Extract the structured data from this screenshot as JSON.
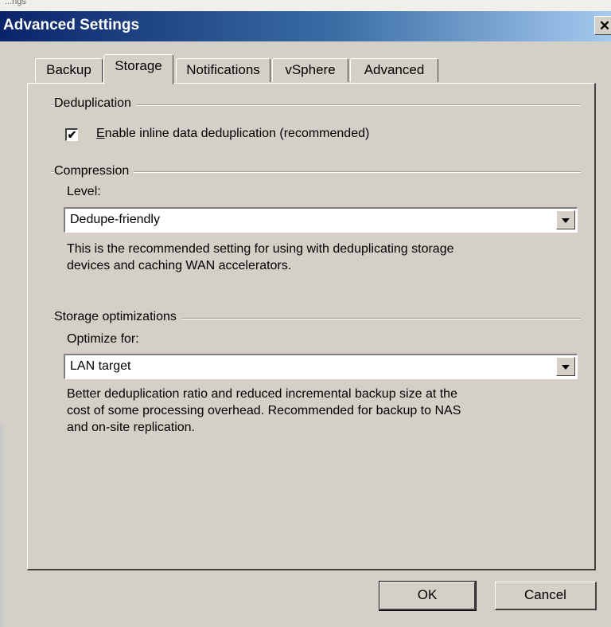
{
  "window": {
    "caption_fragment": "...ngs",
    "title": "Advanced Settings",
    "close_glyph": "✕"
  },
  "tabs": [
    {
      "label": "Backup",
      "active": false
    },
    {
      "label": "Storage",
      "active": true
    },
    {
      "label": "Notifications",
      "active": false
    },
    {
      "label": "vSphere",
      "active": false
    },
    {
      "label": "Advanced",
      "active": false
    }
  ],
  "deduplication": {
    "group_label": "Deduplication",
    "checkbox_checked": true,
    "checkbox_mark": "✔",
    "checkbox_label_accel": "E",
    "checkbox_label_rest": "nable inline data deduplication (recommended)"
  },
  "compression": {
    "group_label": "Compression",
    "field_label": "Level:",
    "selected": "Dedupe-friendly",
    "description_line1": "This is the recommended setting for using with deduplicating storage",
    "description_line2": "devices and caching WAN accelerators."
  },
  "storage_optimizations": {
    "group_label": "Storage optimizations",
    "field_label": "Optimize for:",
    "selected": "LAN target",
    "description_line1": "Better deduplication ratio and reduced incremental backup size at the",
    "description_line2": "cost of some processing overhead. Recommended for backup to NAS",
    "description_line3": "and on-site replication."
  },
  "buttons": {
    "ok": "OK",
    "cancel": "Cancel"
  },
  "colors": {
    "dialog_bg": "#d4d0c8",
    "titlebar_start": "#0a246a",
    "titlebar_end": "#a6caf0"
  }
}
